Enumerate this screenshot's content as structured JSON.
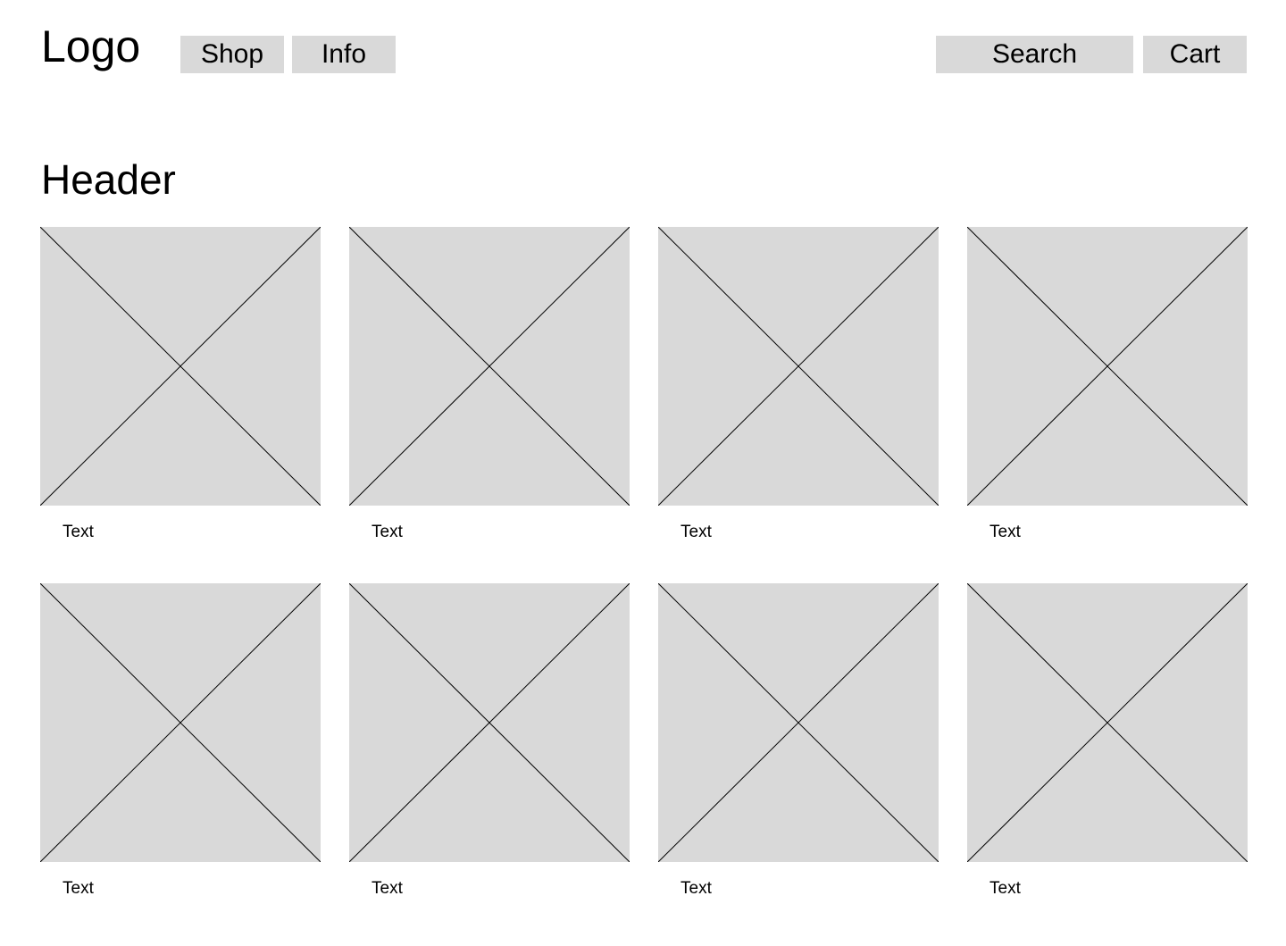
{
  "nav": {
    "logo": "Logo",
    "shop_label": "Shop",
    "info_label": "Info",
    "search_label": "Search",
    "cart_label": "Cart"
  },
  "main": {
    "header": "Header",
    "products": [
      {
        "caption": "Text"
      },
      {
        "caption": "Text"
      },
      {
        "caption": "Text"
      },
      {
        "caption": "Text"
      },
      {
        "caption": "Text"
      },
      {
        "caption": "Text"
      },
      {
        "caption": "Text"
      },
      {
        "caption": "Text"
      }
    ]
  },
  "colors": {
    "placeholder_fill": "#d9d9d9",
    "button_fill": "#d9d9d9",
    "text": "#000000",
    "background": "#ffffff"
  },
  "icons": {
    "image_placeholder": "image-placeholder-icon"
  }
}
